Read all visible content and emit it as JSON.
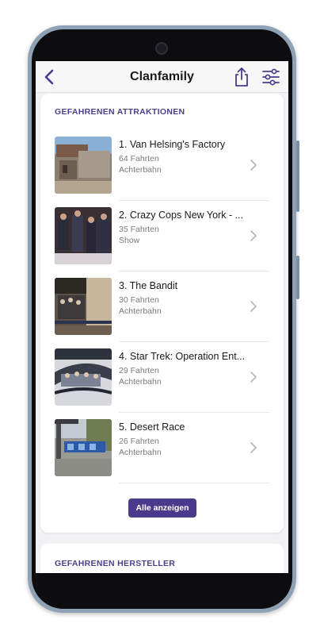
{
  "navbar": {
    "title": "Clanfamily",
    "back_icon": "chevron-left-icon",
    "share_icon": "share-icon",
    "filter_icon": "sliders-icon"
  },
  "attractions": {
    "section_title": "GEFAHRENEN ATTRAKTIONEN",
    "items": [
      {
        "name": "1. Van Helsing's Factory",
        "count": "64 Fahrten",
        "type": "Achterbahn"
      },
      {
        "name": "2. Crazy Cops New York - ...",
        "count": "35 Fahrten",
        "type": "Show"
      },
      {
        "name": "3. The Bandit",
        "count": "30 Fahrten",
        "type": "Achterbahn"
      },
      {
        "name": "4. Star Trek: Operation Ent...",
        "count": "29 Fahrten",
        "type": "Achterbahn"
      },
      {
        "name": "5. Desert Race",
        "count": "26 Fahrten",
        "type": "Achterbahn"
      }
    ],
    "show_all_label": "Alle anzeigen"
  },
  "manufacturers": {
    "section_title": "GEFAHRENEN HERSTELLER"
  },
  "colors": {
    "accent": "#4a3a8c",
    "section_title": "#4d3f8e"
  }
}
